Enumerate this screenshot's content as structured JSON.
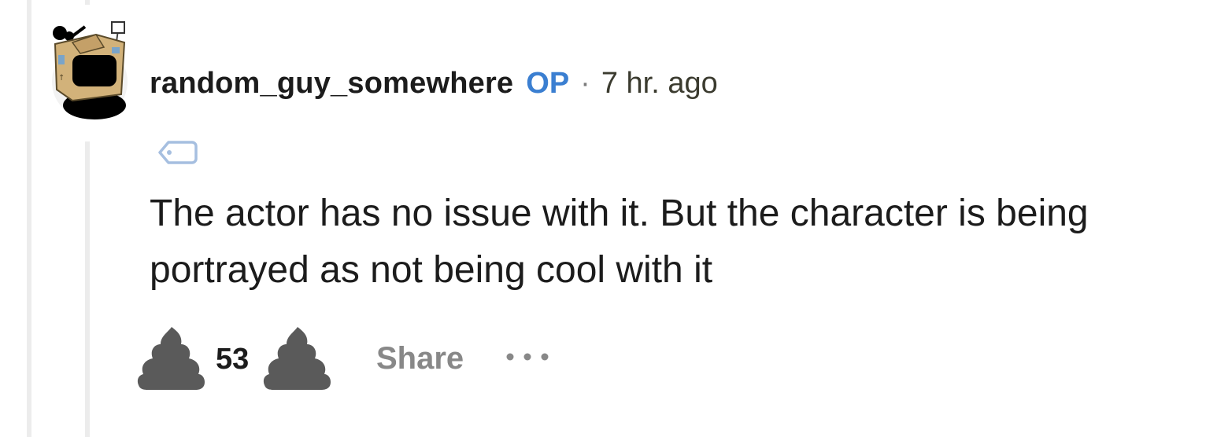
{
  "comment": {
    "author": "random_guy_somewhere",
    "op_badge": "OP",
    "separator": "·",
    "timestamp": "7 hr. ago",
    "body": "The actor has no issue with it. But the character is being portrayed as not being cool with it",
    "flair_icon": "tag-icon"
  },
  "actions": {
    "upvote_icon": "poop-upvote-icon",
    "vote_count": "53",
    "downvote_icon": "poop-downvote-icon",
    "share_label": "Share",
    "more_icon": "ellipsis-icon"
  },
  "colors": {
    "op_badge": "#3b7fd1",
    "thread_line": "#ececec",
    "vote_icon": "#5a5a5a",
    "share_text": "#888888",
    "flair_icon": "#a6bfe0"
  }
}
